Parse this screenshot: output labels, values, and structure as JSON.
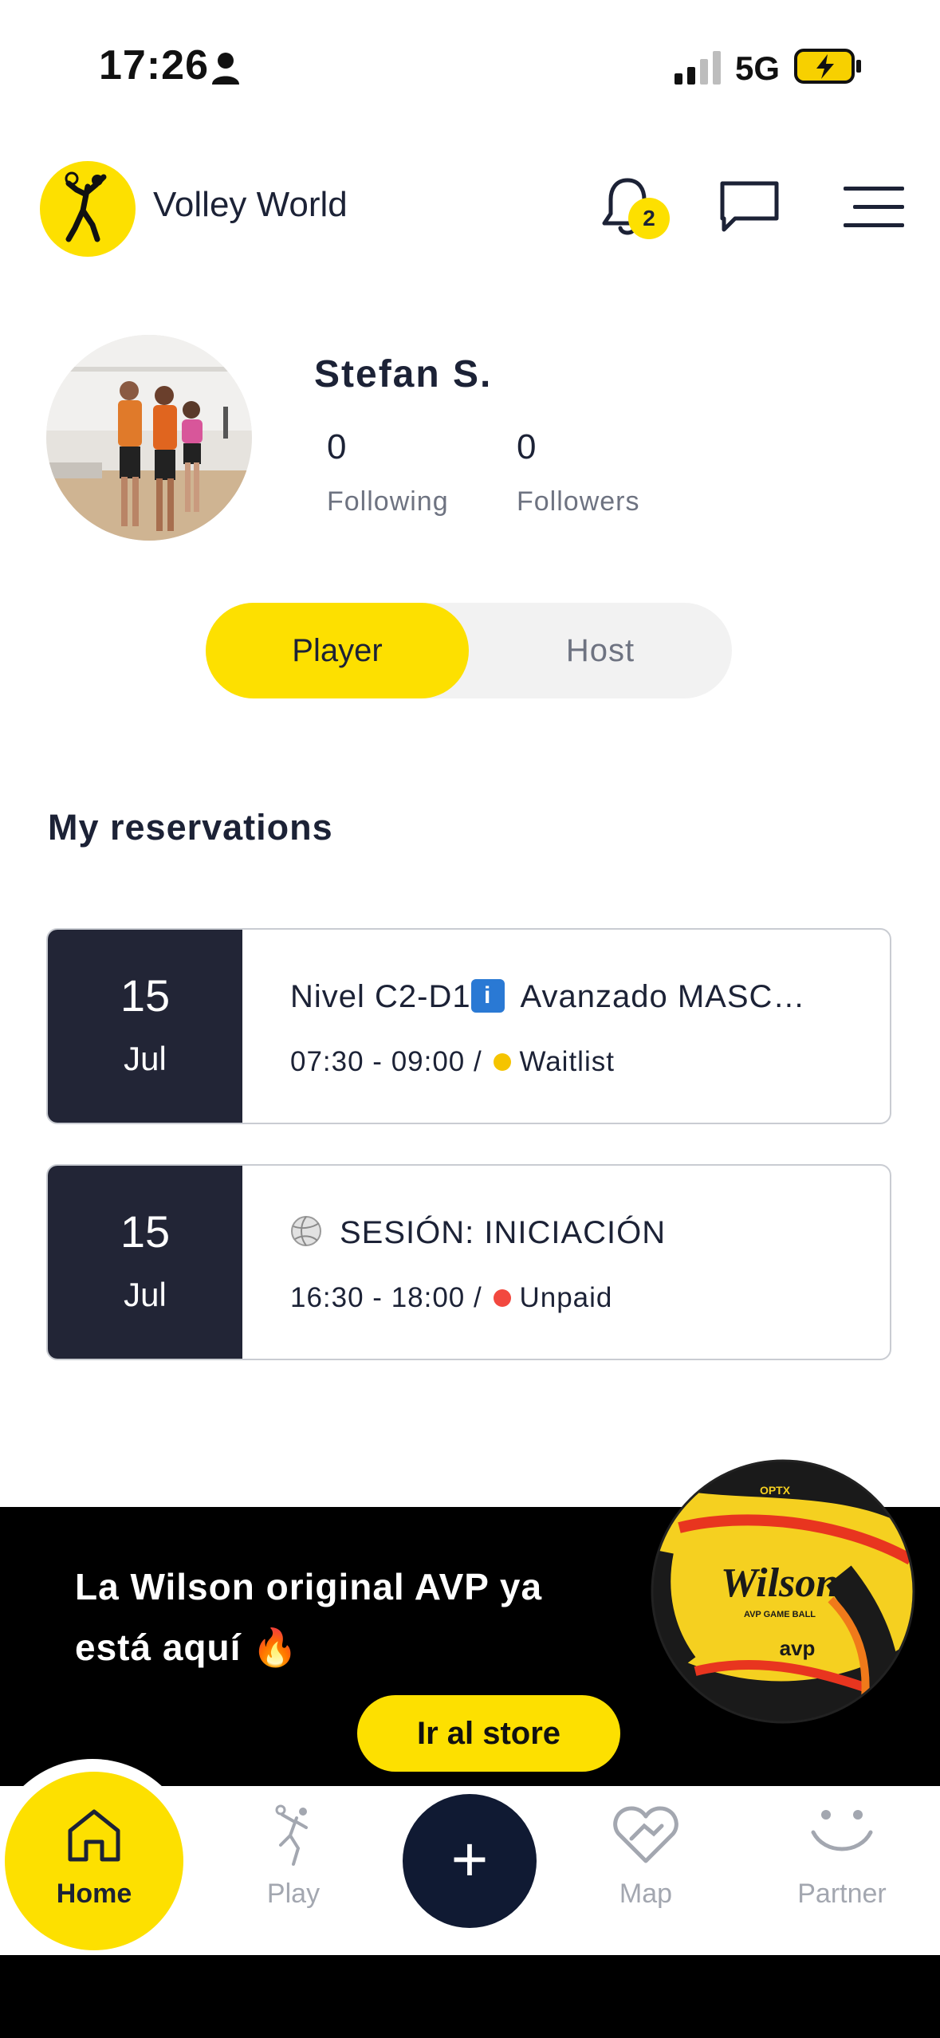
{
  "status_bar": {
    "time": "17:26",
    "network": "5G"
  },
  "header": {
    "brand": "Volley World",
    "notification_count": "2"
  },
  "profile": {
    "name": "Stefan S.",
    "following_count": "0",
    "following_label": "Following",
    "followers_count": "0",
    "followers_label": "Followers"
  },
  "toggle": {
    "active": "Player",
    "inactive": "Host"
  },
  "reservations": {
    "title": "My reservations",
    "items": [
      {
        "day": "15",
        "month": "Jul",
        "title_prefix": "Nivel C2-D1",
        "title_suffix": " Avanzado MASC…",
        "time": "07:30 - 09:00 /",
        "status": "Waitlist",
        "status_color": "#f5c400"
      },
      {
        "day": "15",
        "month": "Jul",
        "title": "SESIÓN: INICIACIÓN",
        "time": "16:30 - 18:00 /",
        "status": "Unpaid",
        "status_color": "#f2483f"
      }
    ]
  },
  "banner": {
    "line1": "La Wilson original AVP ya",
    "line2": "está aquí 🔥",
    "button": "Ir al store",
    "ball_brand": "Wilson",
    "ball_sub": "avp",
    "ball_model": "OPTX",
    "ball_caption": "AVP GAME BALL"
  },
  "bottom_nav": {
    "home": "Home",
    "play": "Play",
    "add": "+",
    "map": "Map",
    "partner": "Partner"
  },
  "colors": {
    "accent": "#fde000",
    "dark": "#222536",
    "navy": "#101a33"
  }
}
